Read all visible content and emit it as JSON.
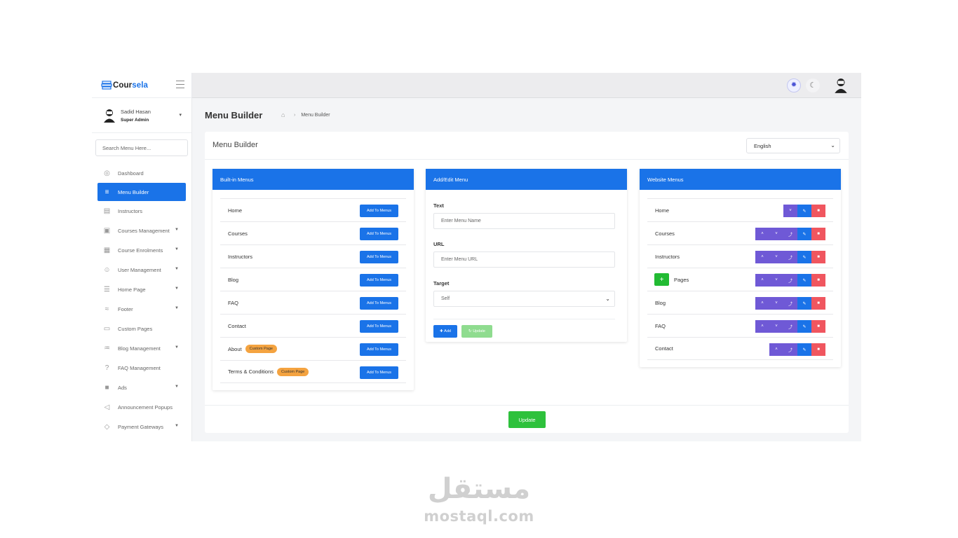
{
  "brand": {
    "name_part1": "Cour",
    "name_part2": "sela"
  },
  "user": {
    "name": "Sadid Hasan",
    "role": "Super Admin"
  },
  "sidebar": {
    "search_placeholder": "Search Menu Here...",
    "items": [
      {
        "label": "Dashboard",
        "icon": "dashboard-icon",
        "glyph": "◎",
        "caret": false,
        "active": false
      },
      {
        "label": "Menu Builder",
        "icon": "menu-icon",
        "glyph": "≡",
        "caret": false,
        "active": true
      },
      {
        "label": "Instructors",
        "icon": "instructor-icon",
        "glyph": "▤",
        "caret": false,
        "active": false
      },
      {
        "label": "Courses Management",
        "icon": "courses-icon",
        "glyph": "▣",
        "caret": true,
        "active": false
      },
      {
        "label": "Course Enrolments",
        "icon": "enrolments-icon",
        "glyph": "▦",
        "caret": true,
        "active": false
      },
      {
        "label": "User Management",
        "icon": "users-icon",
        "glyph": "☺",
        "caret": true,
        "active": false
      },
      {
        "label": "Home Page",
        "icon": "layers-icon",
        "glyph": "☰",
        "caret": true,
        "active": false
      },
      {
        "label": "Footer",
        "icon": "footer-icon",
        "glyph": "≈",
        "caret": true,
        "active": false
      },
      {
        "label": "Custom Pages",
        "icon": "page-icon",
        "glyph": "▭",
        "caret": false,
        "active": false
      },
      {
        "label": "Blog Management",
        "icon": "blog-icon",
        "glyph": "♒",
        "caret": true,
        "active": false
      },
      {
        "label": "FAQ Management",
        "icon": "faq-icon",
        "glyph": "?",
        "caret": false,
        "active": false
      },
      {
        "label": "Ads",
        "icon": "ads-icon",
        "glyph": "■",
        "caret": true,
        "active": false
      },
      {
        "label": "Announcement Popups",
        "icon": "megaphone-icon",
        "glyph": "◁",
        "caret": false,
        "active": false
      },
      {
        "label": "Payment Gateways",
        "icon": "payment-icon",
        "glyph": "◇",
        "caret": true,
        "active": false
      }
    ]
  },
  "header": {
    "title": "Menu Builder",
    "breadcrumb": "Menu Builder"
  },
  "card": {
    "title": "Menu Builder",
    "language": "English",
    "update_label": "Update"
  },
  "builtin": {
    "title": "Built-in Menus",
    "add_label": "Add To Menus",
    "items": [
      {
        "label": "Home",
        "badge": ""
      },
      {
        "label": "Courses",
        "badge": ""
      },
      {
        "label": "Instructors",
        "badge": ""
      },
      {
        "label": "Blog",
        "badge": ""
      },
      {
        "label": "FAQ",
        "badge": ""
      },
      {
        "label": "Contact",
        "badge": ""
      },
      {
        "label": "About",
        "badge": "Custom Page"
      },
      {
        "label": "Terms & Conditions",
        "badge": "Custom Page"
      }
    ]
  },
  "form": {
    "title": "Add/Edit Menu",
    "text_label": "Text",
    "text_placeholder": "Enter Menu Name",
    "url_label": "URL",
    "url_placeholder": "Enter Menu URL",
    "target_label": "Target",
    "target_value": "Self",
    "add_label": "Add",
    "update_label": "Update"
  },
  "website": {
    "title": "Website Menus",
    "items": [
      {
        "label": "Home",
        "up": false,
        "down": true,
        "out": false,
        "plus": false
      },
      {
        "label": "Courses",
        "up": true,
        "down": true,
        "out": true,
        "plus": false
      },
      {
        "label": "Instructors",
        "up": true,
        "down": true,
        "out": true,
        "plus": false
      },
      {
        "label": "Pages",
        "up": true,
        "down": true,
        "out": true,
        "plus": true
      },
      {
        "label": "Blog",
        "up": true,
        "down": true,
        "out": true,
        "plus": false
      },
      {
        "label": "FAQ",
        "up": true,
        "down": true,
        "out": true,
        "plus": false
      },
      {
        "label": "Contact",
        "up": true,
        "down": false,
        "out": true,
        "plus": false
      }
    ]
  },
  "watermark": {
    "arabic": "مستقل",
    "latin": "mostaql.com"
  },
  "colors": {
    "primary": "#1a73e8",
    "success": "#2ec13c",
    "move": "#6f59d6",
    "danger": "#f0565f",
    "badge": "#f4a340"
  }
}
